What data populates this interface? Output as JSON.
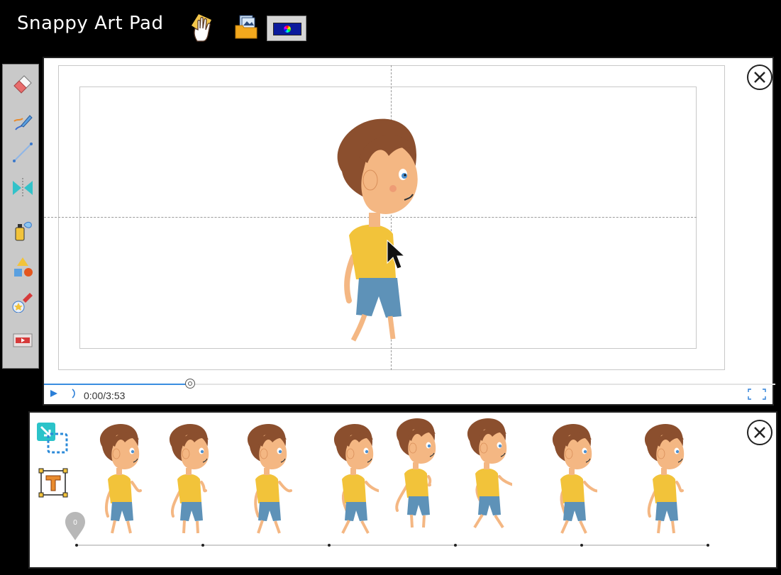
{
  "app": {
    "title": "Snappy Art Pad"
  },
  "top_toolbar": {
    "items": [
      {
        "icon": "hand-icon"
      },
      {
        "icon": "image-folder-icon"
      },
      {
        "icon": "color-picker-icon"
      }
    ]
  },
  "tools": [
    {
      "icon": "eraser-icon"
    },
    {
      "icon": "brush-icon"
    },
    {
      "icon": "line-icon"
    },
    {
      "icon": "mirror-icon"
    },
    {
      "icon": "spray-icon"
    },
    {
      "icon": "shapes-icon"
    },
    {
      "icon": "stamp-icon"
    },
    {
      "icon": "film-icon"
    }
  ],
  "player": {
    "current_time": "0:00",
    "duration": "3:53",
    "time_display": "0:00/3:53",
    "progress_fraction": 0.2
  },
  "frames": {
    "count": 8,
    "marker_label": "0"
  },
  "colors": {
    "background": "#000000",
    "panel": "#ffffff",
    "accent": "#3a8de0",
    "toolbar": "#c9c9c9"
  }
}
